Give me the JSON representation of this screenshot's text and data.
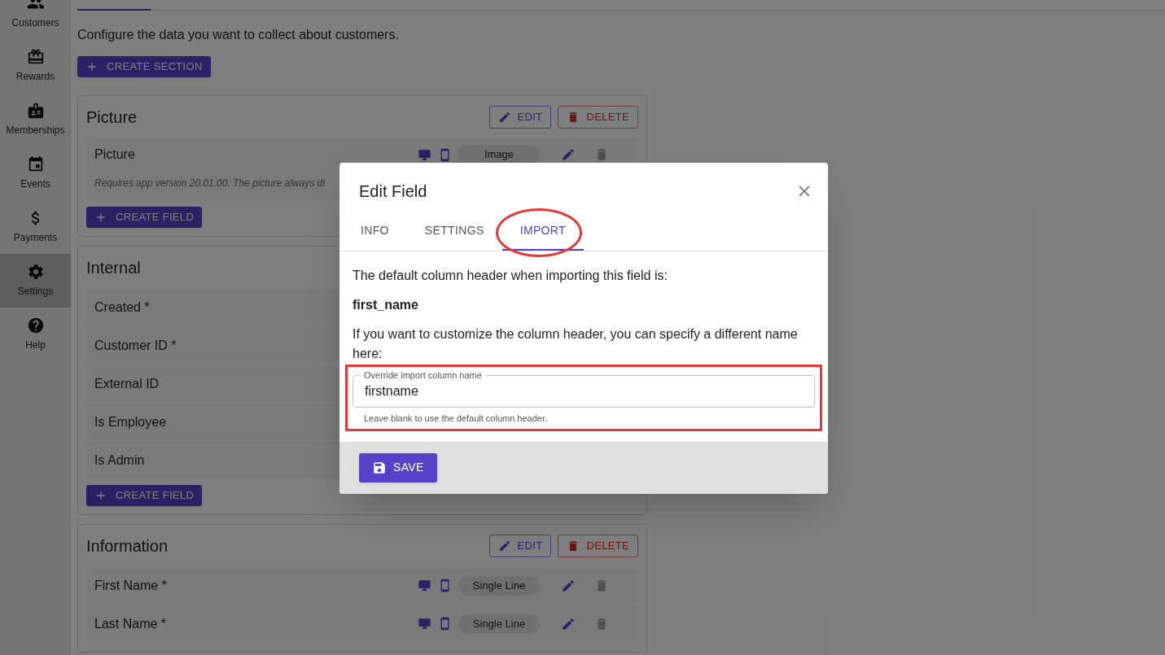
{
  "sidebar": {
    "items": [
      {
        "label": "Customers",
        "selected": false
      },
      {
        "label": "Rewards",
        "selected": false
      },
      {
        "label": "Memberships",
        "selected": false
      },
      {
        "label": "Events",
        "selected": false
      },
      {
        "label": "Payments",
        "selected": false
      },
      {
        "label": "Settings",
        "selected": true
      },
      {
        "label": "Help",
        "selected": false
      }
    ]
  },
  "page": {
    "intro": "Configure the data you want to collect about customers.",
    "create_section": "CREATE SECTION",
    "sections": [
      {
        "title": "Picture",
        "edit": "EDIT",
        "delete": "DELETE",
        "create_field": "CREATE FIELD",
        "fields": [
          {
            "label": "Picture",
            "type": "Image",
            "description": "Requires app version 20.01.00. The picture always di"
          }
        ]
      },
      {
        "title": "Internal",
        "create_field": "CREATE FIELD",
        "fields": [
          {
            "label": "Created *"
          },
          {
            "label": "Customer ID *"
          },
          {
            "label": "External ID"
          },
          {
            "label": "Is Employee"
          },
          {
            "label": "Is Admin"
          }
        ]
      },
      {
        "title": "Information",
        "edit": "EDIT",
        "delete": "DELETE",
        "fields": [
          {
            "label": "First Name *",
            "type": "Single Line"
          },
          {
            "label": "Last Name *",
            "type": "Single Line"
          }
        ]
      }
    ]
  },
  "dialog": {
    "title": "Edit Field",
    "tabs": [
      {
        "label": "INFO",
        "selected": false,
        "highlighted": false
      },
      {
        "label": "SETTINGS",
        "selected": false,
        "highlighted": false
      },
      {
        "label": "IMPORT",
        "selected": true,
        "highlighted": true
      }
    ],
    "intro": "The default column header when importing this field is:",
    "default_header": "first_name",
    "hint": "If you want to customize the column header, you can specify a different name here:",
    "field": {
      "label": "Override import column name",
      "value": "firstname",
      "helper": "Leave blank to use the default column header.",
      "highlighted": true
    },
    "save": "SAVE"
  }
}
